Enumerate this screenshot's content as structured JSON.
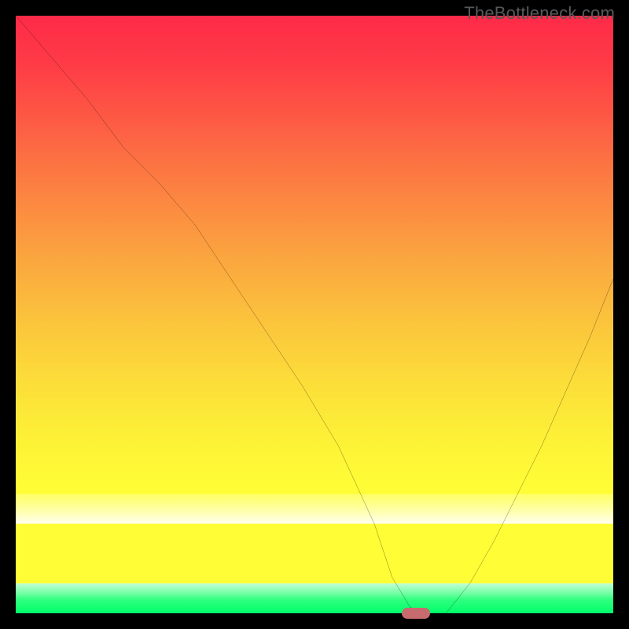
{
  "watermark": "TheBottleneck.com",
  "chart_data": {
    "type": "line",
    "title": "",
    "xlabel": "",
    "ylabel": "",
    "xlim": [
      0,
      100
    ],
    "ylim": [
      0,
      100
    ],
    "legend": false,
    "grid": false,
    "background": {
      "gradient": "red-to-green vertical",
      "stops": [
        {
          "pos": 0,
          "color": "#fe2a48"
        },
        {
          "pos": 50,
          "color": "#fbc63c"
        },
        {
          "pos": 80,
          "color": "#fffd36"
        },
        {
          "pos": 95,
          "color": "#ffffe0"
        },
        {
          "pos": 100,
          "color": "#00ff6a"
        }
      ]
    },
    "series": [
      {
        "name": "bottleneck-curve",
        "x": [
          0,
          6,
          12,
          18,
          24,
          30,
          36,
          42,
          48,
          54,
          60,
          63,
          66,
          69,
          72,
          76,
          80,
          84,
          88,
          92,
          96,
          100
        ],
        "y": [
          100,
          93,
          86,
          78,
          72,
          65,
          56,
          47,
          38,
          28,
          15,
          6,
          1,
          0,
          0,
          5,
          12,
          20,
          28,
          37,
          46,
          56
        ]
      }
    ],
    "annotations": [
      {
        "name": "optimal-marker",
        "shape": "rounded-rect",
        "x": 67,
        "y": 0,
        "color": "#c76b6e"
      }
    ]
  }
}
